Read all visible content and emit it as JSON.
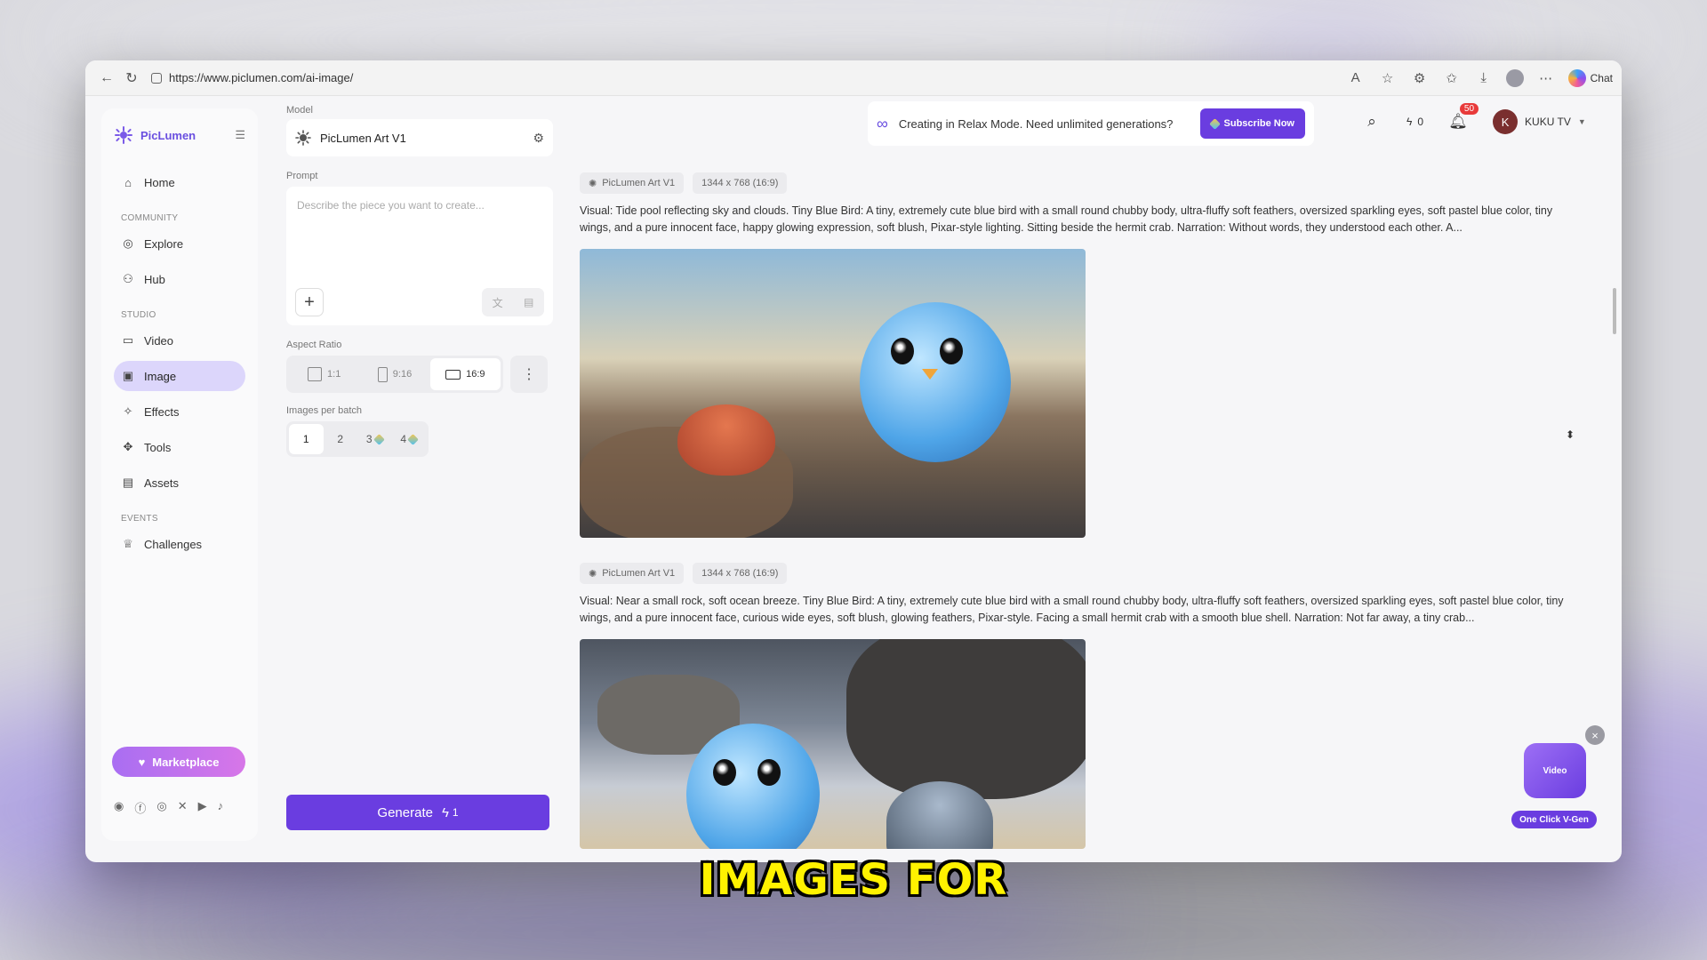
{
  "browser": {
    "url": "https://www.piclumen.com/ai-image/",
    "chat_label": "Chat"
  },
  "sidebar": {
    "brand": "PicLumen",
    "items": [
      {
        "label": "Home",
        "icon": "home-icon"
      },
      {
        "label": "Explore",
        "icon": "compass-icon"
      },
      {
        "label": "Hub",
        "icon": "users-icon"
      },
      {
        "label": "Video",
        "icon": "video-icon"
      },
      {
        "label": "Image",
        "icon": "image-icon",
        "active": true
      },
      {
        "label": "Effects",
        "icon": "wand-icon"
      },
      {
        "label": "Tools",
        "icon": "tools-icon"
      },
      {
        "label": "Assets",
        "icon": "folder-icon"
      },
      {
        "label": "Challenges",
        "icon": "trophy-icon"
      }
    ],
    "sections": {
      "community": "COMMUNITY",
      "studio": "STUDIO",
      "events": "EVENTS"
    },
    "marketplace_label": "Marketplace"
  },
  "panel": {
    "model_label": "Model",
    "model_value": "PicLumen Art V1",
    "prompt_label": "Prompt",
    "prompt_placeholder": "Describe the piece you want to create...",
    "aspect_label": "Aspect Ratio",
    "aspect_options": [
      "1:1",
      "9:16",
      "16:9"
    ],
    "aspect_selected": "16:9",
    "batch_label": "Images per batch",
    "batch_options": [
      "1",
      "2",
      "3",
      "4"
    ],
    "batch_selected": "1",
    "generate_label": "Generate",
    "generate_cost": "1"
  },
  "topbar": {
    "relax_text": "Creating in Relax Mode. Need unlimited generations?",
    "subscribe_label": "Subscribe Now",
    "credits": "0",
    "notifications": "50",
    "user_initial": "K",
    "user_name": "KUKU TV"
  },
  "feed": [
    {
      "model": "PicLumen Art V1",
      "size": "1344 x 768 (16:9)",
      "prompt": "Visual: Tide pool reflecting sky and clouds. Tiny Blue Bird: A tiny, extremely cute blue bird with a small round chubby body, ultra-fluffy soft feathers, oversized sparkling eyes, soft pastel blue color, tiny wings, and a pure innocent face, happy glowing expression, soft blush, Pixar-style lighting. Sitting beside the hermit crab. Narration: Without words, they understood each other. A..."
    },
    {
      "model": "PicLumen Art V1",
      "size": "1344 x 768 (16:9)",
      "prompt": "Visual: Near a small rock, soft ocean breeze. Tiny Blue Bird: A tiny, extremely cute blue bird with a small round chubby body, ultra-fluffy soft feathers, oversized sparkling eyes, soft pastel blue color, tiny wings, and a pure innocent face, curious wide eyes, soft blush, glowing feathers, Pixar-style. Facing a small hermit crab with a smooth blue shell. Narration: Not far away, a tiny crab..."
    }
  ],
  "widget": {
    "vgen_label": "One Click V-Gen",
    "tv_text": "Video"
  },
  "caption": "IMAGES FOR",
  "colors": {
    "accent": "#6a3de0",
    "active_nav": "#dcd6fb",
    "caption": "#fff200"
  }
}
